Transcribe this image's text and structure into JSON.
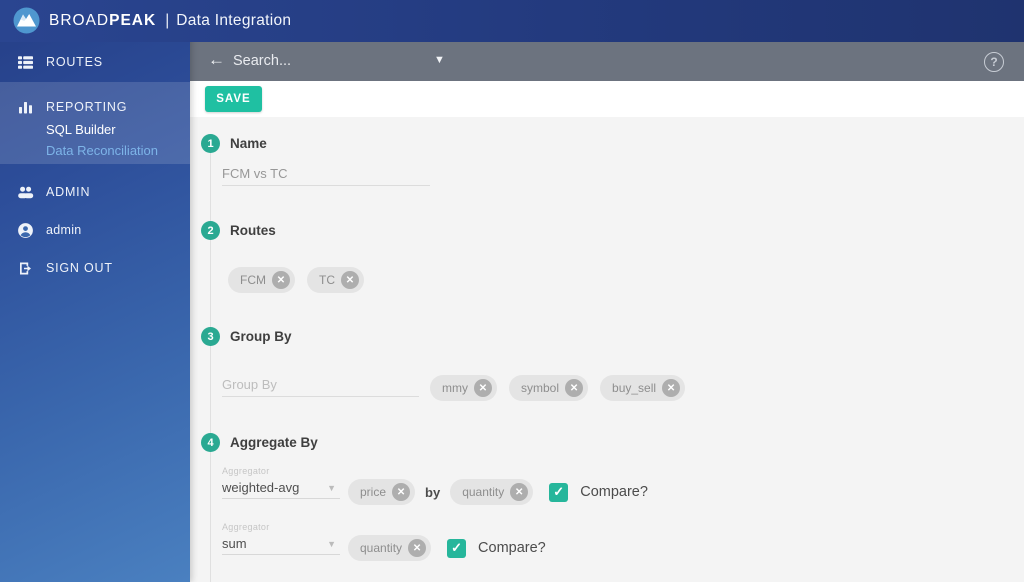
{
  "header": {
    "brand_regular": "BROAD",
    "brand_bold": "PEAK",
    "divider": "|",
    "app_title": "Data Integration"
  },
  "sidebar": {
    "routes": "ROUTES",
    "reporting": "REPORTING",
    "sql_builder": "SQL Builder",
    "data_reconciliation": "Data Reconciliation",
    "admin_section": "ADMIN",
    "user": "admin",
    "sign_out": "SIGN OUT"
  },
  "searchbar": {
    "placeholder": "Search..."
  },
  "toolbar": {
    "save_label": "SAVE"
  },
  "form": {
    "steps": [
      {
        "number": "1",
        "label": "Name",
        "value": "FCM vs TC"
      },
      {
        "number": "2",
        "label": "Routes",
        "chips": [
          "FCM",
          "TC"
        ]
      },
      {
        "number": "3",
        "label": "Group By",
        "placeholder": "Group By",
        "chips": [
          "mmy",
          "symbol",
          "buy_sell"
        ]
      },
      {
        "number": "4",
        "label": "Aggregate By"
      }
    ],
    "aggregations": [
      {
        "aggregator_label": "Aggregator",
        "value": "weighted-avg",
        "chip_a": "price",
        "joiner": "by",
        "chip_b": "quantity",
        "compare_label": "Compare?",
        "checked": true
      },
      {
        "aggregator_label": "Aggregator",
        "value": "sum",
        "chip_a": "quantity",
        "compare_label": "Compare?",
        "checked": true
      }
    ]
  },
  "icons": {
    "back_arrow": "←",
    "dropdown_caret": "▼",
    "select_caret": "▼",
    "help": "?",
    "remove": "✕",
    "checkmark": "✓"
  },
  "colors": {
    "accent_teal": "#1fc0a2",
    "step_teal": "#2aa992",
    "header_navy": "#243a80",
    "sidebar_blue_top": "#253e86",
    "sidebar_blue_bottom": "#4a80c0",
    "topbar_gray": "#6c737f",
    "active_link_blue": "#7db4e8",
    "content_bg": "#f4f4f4"
  }
}
